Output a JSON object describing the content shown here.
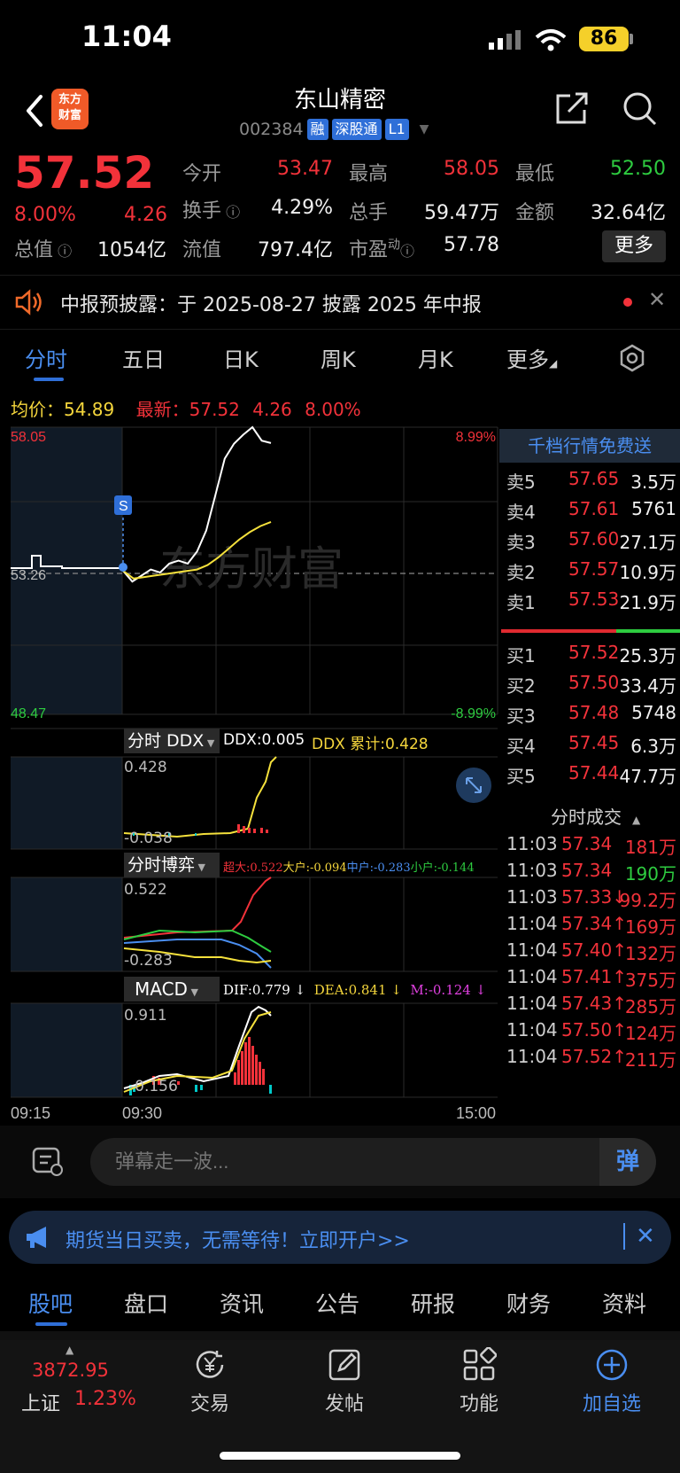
{
  "status_bar": {
    "time": "11:04",
    "battery": "86"
  },
  "header": {
    "stock_name": "东山精密",
    "stock_code": "002384",
    "tags": [
      "融",
      "深股通",
      "L1"
    ],
    "logo_text": "东方财富"
  },
  "quote": {
    "price": "57.52",
    "change_pct": "8.00%",
    "change": "4.26",
    "fields": [
      {
        "label": "今开",
        "value": "53.47",
        "color": "red"
      },
      {
        "label": "最高",
        "value": "58.05",
        "color": "red"
      },
      {
        "label": "最低",
        "value": "52.50",
        "color": "green"
      },
      {
        "label": "换手",
        "value": "4.29%",
        "color": "white"
      },
      {
        "label": "总手",
        "value": "59.47万",
        "color": "white"
      },
      {
        "label": "金额",
        "value": "32.64亿",
        "color": "white"
      },
      {
        "label": "总值",
        "value": "1054亿",
        "color": "white"
      },
      {
        "label": "流值",
        "value": "797.4亿",
        "color": "white"
      },
      {
        "label": "市盈",
        "label_sup": "动",
        "value": "57.78",
        "color": "white"
      }
    ],
    "more_label": "更多"
  },
  "notice": {
    "text": "中报预披露：于 2025-08-27 披露 2025 年中报"
  },
  "chart_tabs": [
    "分时",
    "五日",
    "日K",
    "周K",
    "月K",
    "更多"
  ],
  "avg_row": {
    "avg_label": "均价：",
    "avg_value": "54.89",
    "latest_label": "最新：",
    "latest_value": "57.52",
    "latest_change": "4.26",
    "latest_pct": "8.00%"
  },
  "chart_labels": {
    "high": "58.05",
    "mid": "53.26",
    "low": "48.47",
    "high_pct": "8.99%",
    "low_pct": "-8.99%",
    "watermark": "东方财富",
    "marker": "S",
    "time_start": "09:15",
    "time_open": "09:30",
    "time_end": "15:00"
  },
  "chart_data": {
    "type": "line",
    "x_range": [
      "09:30",
      "15:00"
    ],
    "ylim": [
      48.47,
      58.05
    ],
    "prev_close": 53.26,
    "series": [
      {
        "values": [
          53.26,
          52.9,
          53.1,
          53.3,
          53.2,
          53.5,
          53.6,
          53.5,
          53.9,
          54.6,
          55.8,
          57.0,
          57.5,
          57.8,
          58.05,
          57.6,
          57.52
        ]
      },
      {
        "values": [
          53.26,
          53.0,
          53.05,
          53.1,
          53.15,
          53.2,
          53.25,
          53.3,
          53.45,
          53.7,
          54.0,
          54.3,
          54.55,
          54.75,
          54.89
        ]
      }
    ]
  },
  "ddx_panel": {
    "selector": "分时 DDX",
    "ddx_label": "DDX:0.005",
    "ddx_cum_label": "DDX 累计:0.428",
    "top": "0.428",
    "bottom": "-0.038"
  },
  "boyi_panel": {
    "selector": "分时博弈",
    "super": "超大:0.522",
    "large": "大户:-0.094",
    "mid": "中户:-0.283",
    "small": "小户:-0.144",
    "top": "0.522",
    "bottom": "-0.283"
  },
  "macd_panel": {
    "selector": "MACD",
    "dif": "DIF:0.779 ↓",
    "dea": "DEA:0.841 ↓",
    "m": "M:-0.124 ↓",
    "top": "0.911",
    "bottom": "-0.156"
  },
  "order_book": {
    "banner": "千档行情免费送",
    "asks": [
      {
        "label": "卖5",
        "price": "57.65",
        "vol": "3.5万"
      },
      {
        "label": "卖4",
        "price": "57.61",
        "vol": "5761"
      },
      {
        "label": "卖3",
        "price": "57.60",
        "vol": "27.1万"
      },
      {
        "label": "卖2",
        "price": "57.57",
        "vol": "10.9万"
      },
      {
        "label": "卖1",
        "price": "57.53",
        "vol": "21.9万"
      }
    ],
    "bids": [
      {
        "label": "买1",
        "price": "57.52",
        "vol": "25.3万"
      },
      {
        "label": "买2",
        "price": "57.50",
        "vol": "33.4万"
      },
      {
        "label": "买3",
        "price": "57.48",
        "vol": "5748"
      },
      {
        "label": "买4",
        "price": "57.45",
        "vol": "6.3万"
      },
      {
        "label": "买5",
        "price": "57.44",
        "vol": "47.7万"
      }
    ],
    "trades_title": "分时成交",
    "trades": [
      {
        "time": "11:03",
        "price": "57.34",
        "vol": "181万",
        "dir": "red"
      },
      {
        "time": "11:03",
        "price": "57.34",
        "vol": "190万",
        "dir": "green"
      },
      {
        "time": "11:03",
        "price": "57.33↓",
        "vol": "99.2万",
        "dir": "red"
      },
      {
        "time": "11:04",
        "price": "57.34↑",
        "vol": "169万",
        "dir": "red"
      },
      {
        "time": "11:04",
        "price": "57.40↑",
        "vol": "132万",
        "dir": "red"
      },
      {
        "time": "11:04",
        "price": "57.41↑",
        "vol": "375万",
        "dir": "red"
      },
      {
        "time": "11:04",
        "price": "57.43↑",
        "vol": "285万",
        "dir": "red"
      },
      {
        "time": "11:04",
        "price": "57.50↑",
        "vol": "124万",
        "dir": "red"
      },
      {
        "time": "11:04",
        "price": "57.52↑",
        "vol": "211万",
        "dir": "red"
      }
    ]
  },
  "danmu": {
    "placeholder": "弹幕走一波...",
    "button": "弹"
  },
  "promo": {
    "text": "期货当日买卖，无需等待！立即开户>>"
  },
  "bottom_tabs": [
    "股吧",
    "盘口",
    "资讯",
    "公告",
    "研报",
    "财务",
    "资料"
  ],
  "bottom_nav": {
    "index_value": "3872.95",
    "index_name": "上证",
    "index_pct": "1.23%",
    "items": [
      "交易",
      "发帖",
      "功能",
      "加自选"
    ]
  }
}
